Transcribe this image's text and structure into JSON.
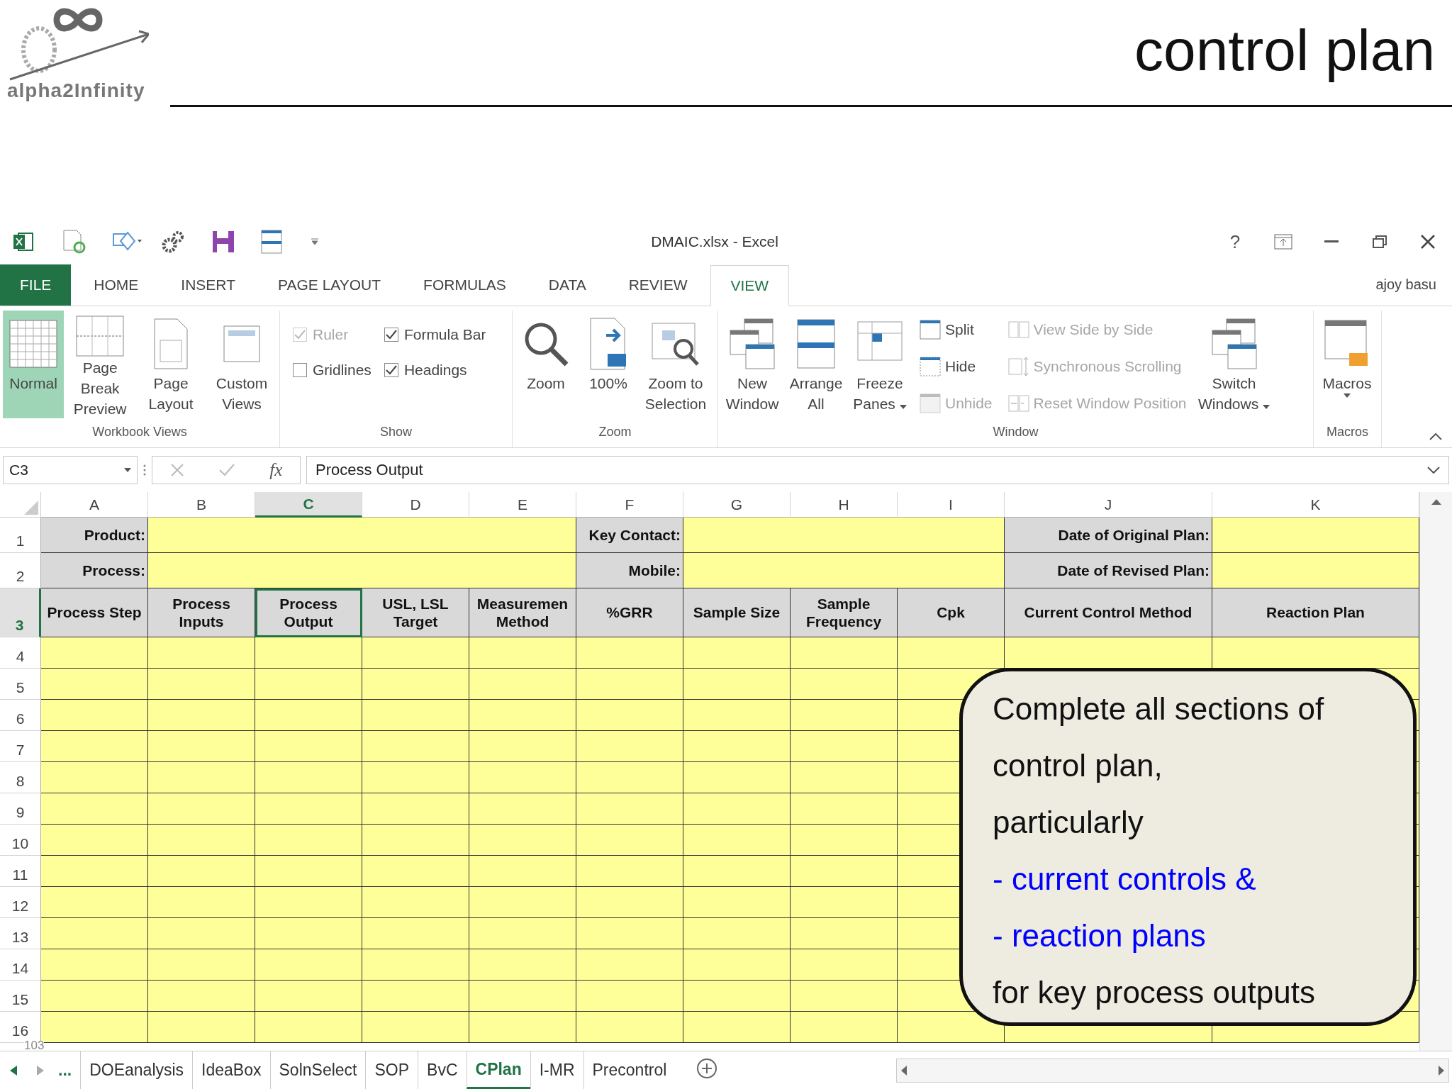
{
  "slide": {
    "title": "control plan",
    "logo_text": "alpha2Infinity",
    "page_number": "103"
  },
  "excel": {
    "window_title": "DMAIC.xlsx - Excel",
    "help": "?",
    "ribbon_tabs": [
      {
        "label": "FILE",
        "kind": "file",
        "selected": false
      },
      {
        "label": "HOME",
        "kind": "tab",
        "selected": false
      },
      {
        "label": "INSERT",
        "kind": "tab",
        "selected": false
      },
      {
        "label": "PAGE LAYOUT",
        "kind": "tab",
        "selected": false
      },
      {
        "label": "FORMULAS",
        "kind": "tab",
        "selected": false
      },
      {
        "label": "DATA",
        "kind": "tab",
        "selected": false
      },
      {
        "label": "REVIEW",
        "kind": "tab",
        "selected": false
      },
      {
        "label": "VIEW",
        "kind": "tab",
        "selected": true
      }
    ],
    "user": "ajoy basu",
    "ribbon": {
      "workbook_views": {
        "label": "Workbook Views",
        "buttons": [
          {
            "lines": [
              "Normal"
            ],
            "selected": true
          },
          {
            "lines": [
              "Page Break",
              "Preview"
            ],
            "selected": false
          },
          {
            "lines": [
              "Page",
              "Layout"
            ],
            "selected": false
          },
          {
            "lines": [
              "Custom",
              "Views"
            ],
            "selected": false
          }
        ]
      },
      "show": {
        "label": "Show",
        "checkboxes": [
          {
            "label": "Ruler",
            "checked": true,
            "disabled": true
          },
          {
            "label": "Formula Bar",
            "checked": true,
            "disabled": false
          },
          {
            "label": "Gridlines",
            "checked": false,
            "disabled": false
          },
          {
            "label": "Headings",
            "checked": true,
            "disabled": false
          }
        ]
      },
      "zoom": {
        "label": "Zoom",
        "buttons": [
          {
            "lines": [
              "Zoom"
            ]
          },
          {
            "lines": [
              "100%"
            ]
          },
          {
            "lines": [
              "Zoom to",
              "Selection"
            ]
          }
        ]
      },
      "window": {
        "label": "Window",
        "large_buttons": [
          {
            "lines": [
              "New",
              "Window"
            ],
            "dropdown": false
          },
          {
            "lines": [
              "Arrange",
              "All"
            ],
            "dropdown": false
          },
          {
            "lines": [
              "Freeze",
              "Panes"
            ],
            "dropdown": true
          }
        ],
        "small_buttons": [
          {
            "label": "Split",
            "disabled": false
          },
          {
            "label": "Hide",
            "disabled": false
          },
          {
            "label": "Unhide",
            "disabled": true
          },
          {
            "label": "View Side by Side",
            "disabled": true
          },
          {
            "label": "Synchronous Scrolling",
            "disabled": true
          },
          {
            "label": "Reset Window Position",
            "disabled": true
          }
        ],
        "switch_button": {
          "lines": [
            "Switch",
            "Windows"
          ],
          "dropdown": true
        }
      },
      "macros": {
        "label": "Macros",
        "button": {
          "lines": [
            "Macros"
          ],
          "dropdown": true
        }
      }
    },
    "formula_bar": {
      "name_box": "C3",
      "function_label": "fx",
      "value": "Process Output"
    },
    "columns": [
      {
        "label": "A",
        "selected": false
      },
      {
        "label": "B",
        "selected": false
      },
      {
        "label": "C",
        "selected": true
      },
      {
        "label": "D",
        "selected": false
      },
      {
        "label": "E",
        "selected": false
      },
      {
        "label": "F",
        "selected": false
      },
      {
        "label": "G",
        "selected": false
      },
      {
        "label": "H",
        "selected": false
      },
      {
        "label": "I",
        "selected": false
      },
      {
        "label": "J",
        "selected": false
      },
      {
        "label": "K",
        "selected": false
      }
    ],
    "info_rows": [
      {
        "number": "1",
        "selected": false,
        "fields": [
          "Product:",
          "Key Contact:",
          "Date of Original Plan:"
        ]
      },
      {
        "number": "2",
        "selected": false,
        "fields": [
          "Process:",
          "Mobile:",
          "Date of Revised Plan:"
        ]
      }
    ],
    "header_row": {
      "number": "3",
      "selected": true,
      "cells": [
        {
          "text": "Process Step",
          "selected": false
        },
        {
          "text": "Process Inputs",
          "selected": false
        },
        {
          "text": "Process Output",
          "selected": true
        },
        {
          "text": "USL, LSL Target",
          "selected": false
        },
        {
          "text": "Measuremen Method",
          "selected": false
        },
        {
          "text": "%GRR",
          "selected": false
        },
        {
          "text": "Sample Size",
          "selected": false
        },
        {
          "text": "Sample Frequency",
          "selected": false
        },
        {
          "text": "Cpk",
          "selected": false
        },
        {
          "text": "Current Control Method",
          "selected": false
        },
        {
          "text": "Reaction Plan",
          "selected": false
        }
      ]
    },
    "empty_rows": [
      {
        "number": "4"
      },
      {
        "number": "5"
      },
      {
        "number": "6"
      },
      {
        "number": "7"
      },
      {
        "number": "8"
      },
      {
        "number": "9"
      },
      {
        "number": "10"
      },
      {
        "number": "11"
      },
      {
        "number": "12"
      },
      {
        "number": "13"
      },
      {
        "number": "14"
      },
      {
        "number": "15"
      },
      {
        "number": "16"
      }
    ],
    "sheet_nav": "...",
    "sheet_tabs": [
      {
        "label": "DOEanalysis",
        "selected": false
      },
      {
        "label": "IdeaBox",
        "selected": false
      },
      {
        "label": "SolnSelect",
        "selected": false
      },
      {
        "label": "SOP",
        "selected": false
      },
      {
        "label": "BvC",
        "selected": false
      },
      {
        "label": "CPlan",
        "selected": true
      },
      {
        "label": "I-MR",
        "selected": false
      },
      {
        "label": "Precontrol",
        "selected": false
      }
    ]
  },
  "callout": {
    "lines": [
      {
        "text": "Complete all sections of",
        "kind": "plain"
      },
      {
        "text": "control plan,",
        "kind": "plain"
      },
      {
        "text": "particularly",
        "kind": "plain"
      },
      {
        "text": "- current controls &",
        "kind": "emphasis"
      },
      {
        "text": "- reaction plans",
        "kind": "emphasis"
      },
      {
        "text": "for key process outputs",
        "kind": "plain"
      }
    ]
  }
}
